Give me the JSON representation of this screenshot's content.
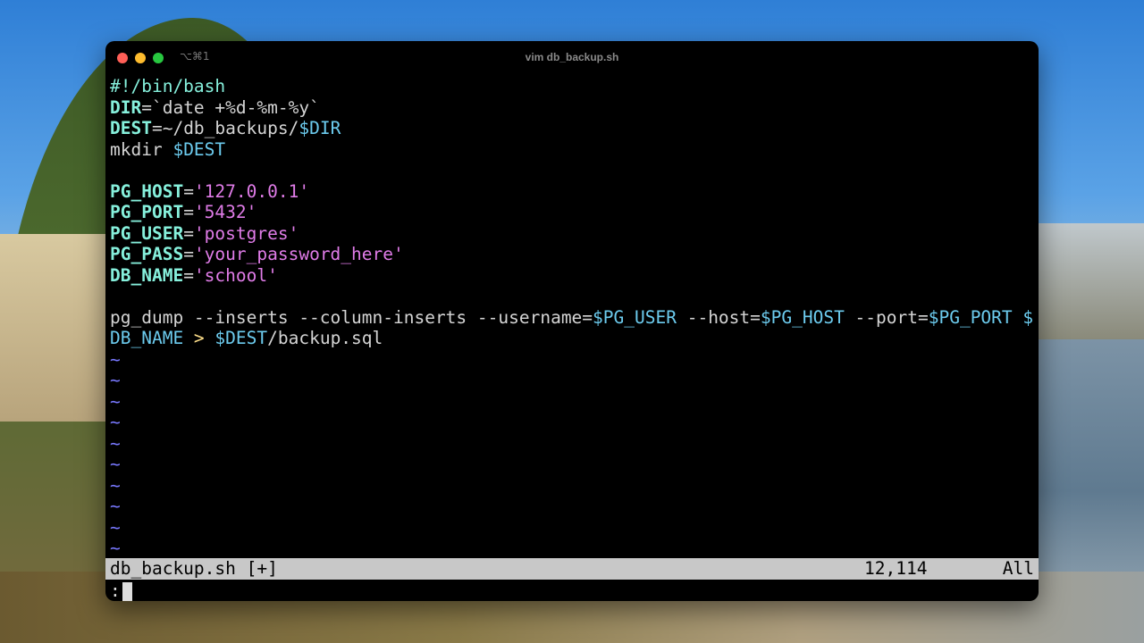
{
  "window": {
    "title": "vim db_backup.sh",
    "shortcut": "⌥⌘1",
    "traffic_lights": {
      "close": "#ff5f57",
      "minimize": "#febc2e",
      "zoom": "#28c840"
    }
  },
  "editor": {
    "lines": [
      [
        {
          "t": "#!/bin/bash",
          "c": "c"
        }
      ],
      [
        {
          "t": "DIR",
          "c": "k"
        },
        {
          "t": "=`date +%d-%m-%y`",
          "c": "p"
        }
      ],
      [
        {
          "t": "DEST",
          "c": "k"
        },
        {
          "t": "=~/db_backups/",
          "c": "p"
        },
        {
          "t": "$DIR",
          "c": "v"
        }
      ],
      [
        {
          "t": "mkdir ",
          "c": "p"
        },
        {
          "t": "$DEST",
          "c": "v"
        }
      ],
      [],
      [
        {
          "t": "PG_HOST",
          "c": "k"
        },
        {
          "t": "=",
          "c": "p"
        },
        {
          "t": "'127.0.0.1'",
          "c": "s"
        }
      ],
      [
        {
          "t": "PG_PORT",
          "c": "k"
        },
        {
          "t": "=",
          "c": "p"
        },
        {
          "t": "'5432'",
          "c": "s"
        }
      ],
      [
        {
          "t": "PG_USER",
          "c": "k"
        },
        {
          "t": "=",
          "c": "p"
        },
        {
          "t": "'postgres'",
          "c": "s"
        }
      ],
      [
        {
          "t": "PG_PASS",
          "c": "k"
        },
        {
          "t": "=",
          "c": "p"
        },
        {
          "t": "'your_password_here'",
          "c": "s"
        }
      ],
      [
        {
          "t": "DB_NAME",
          "c": "k"
        },
        {
          "t": "=",
          "c": "p"
        },
        {
          "t": "'school'",
          "c": "s"
        }
      ],
      [],
      [
        {
          "t": "pg_dump --inserts --column-inserts --username=",
          "c": "p"
        },
        {
          "t": "$PG_USER",
          "c": "v"
        },
        {
          "t": " --host=",
          "c": "p"
        },
        {
          "t": "$PG_HOST",
          "c": "v"
        },
        {
          "t": " --port=",
          "c": "p"
        },
        {
          "t": "$PG_PORT",
          "c": "v"
        },
        {
          "t": " $",
          "c": "v"
        }
      ],
      [
        {
          "t": "DB_NAME",
          "c": "v"
        },
        {
          "t": " > ",
          "c": "o"
        },
        {
          "t": "$DEST",
          "c": "v"
        },
        {
          "t": "/backup.sql",
          "c": "p"
        }
      ]
    ],
    "tilde": "~",
    "tilde_count": 10
  },
  "statusline": {
    "filename": "db_backup.sh [+]",
    "position": "12,114",
    "scroll": "All"
  },
  "cmdline": {
    "text": ":"
  }
}
